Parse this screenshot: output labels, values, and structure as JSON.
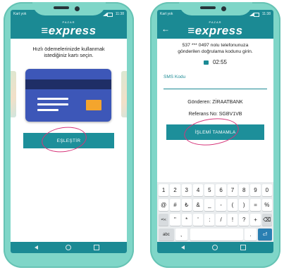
{
  "left_screen": {
    "status": {
      "carrier": "Kart yok",
      "time": "11:38"
    },
    "brand": {
      "small": "PAZAR",
      "logo": "≡express"
    },
    "instruction": [
      "Hızlı ödemelerinizde kullanmak",
      "istediğiniz kartı seçin."
    ],
    "pair_button": "EŞLEŞTİR"
  },
  "right_screen": {
    "status": {
      "carrier": "Kart yok",
      "time": "11:38"
    },
    "brand": {
      "small": "PAZAR",
      "logo": "≡express"
    },
    "back_icon": "←",
    "message": [
      "537 *** 0497 nolu telefonunuza",
      "gönderilen doğrulama kodunu girin."
    ],
    "timer": "02:55",
    "sms_label": "SMS Kodu",
    "sender": "Gönderen: ZİRAATBANK",
    "reference": "Referans No: SGBV1VB",
    "complete_button": "İŞLEMİ TAMAMLA",
    "keyboard": {
      "row1": [
        "1",
        "2",
        "3",
        "4",
        "5",
        "6",
        "7",
        "8",
        "9",
        "0"
      ],
      "row2": [
        "@",
        "#",
        "₺",
        "&",
        "_",
        "-",
        "(",
        ")",
        "=",
        "%"
      ],
      "row3": [
        "=\\<",
        "\"",
        "*",
        "'",
        ":",
        "/",
        "!",
        "?",
        "+",
        "⌫"
      ],
      "row4": [
        "abc",
        ",",
        "",
        "",
        ".",
        "⏎"
      ]
    }
  },
  "colors": {
    "teal": "#1b8a94",
    "phone": "#7fd6c8",
    "card": "#3d57b8",
    "chip": "#f4a52d",
    "annotation": "#d6357a"
  }
}
